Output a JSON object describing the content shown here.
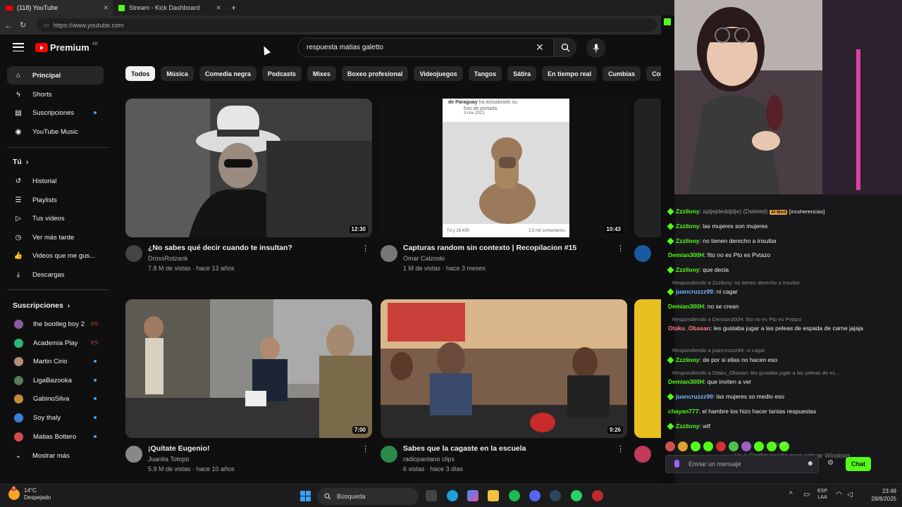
{
  "browser": {
    "tabs": [
      {
        "title": "(118) YouTube",
        "active": true
      },
      {
        "title": "Stream - Kick Dashboard",
        "active": false
      }
    ],
    "url": "https://www.youtube.com"
  },
  "youtube": {
    "logo_text": "Premium",
    "logo_region": "AR",
    "search_value": "respuesta matias galetto",
    "sidebar": {
      "main": [
        {
          "label": "Principal",
          "icon": "home-icon",
          "active": true
        },
        {
          "label": "Shorts",
          "icon": "shorts-icon"
        },
        {
          "label": "Suscripciones",
          "icon": "subscriptions-icon",
          "dot": true
        },
        {
          "label": "YouTube Music",
          "icon": "music-icon"
        }
      ],
      "you_heading": "Tú",
      "you": [
        {
          "label": "Historial",
          "icon": "history-icon"
        },
        {
          "label": "Playlists",
          "icon": "playlists-icon"
        },
        {
          "label": "Tus videos",
          "icon": "your-videos-icon"
        },
        {
          "label": "Ver más tarde",
          "icon": "clock-icon"
        },
        {
          "label": "Videos que me gus...",
          "icon": "thumbs-up-icon"
        },
        {
          "label": "Descargas",
          "icon": "download-icon"
        }
      ],
      "subs_heading": "Suscripciones",
      "subs": [
        {
          "label": "the bootleg boy 2",
          "color": "#8a5a9e",
          "live": true
        },
        {
          "label": "Academia Play",
          "color": "#2bb673",
          "live": true
        },
        {
          "label": "Martin Cirio",
          "color": "#b58d7a",
          "dot": true
        },
        {
          "label": "LigaBazooka",
          "color": "#5a7a5a",
          "dot": true
        },
        {
          "label": "GabinoSilva",
          "color": "#c48a3a",
          "dot": true
        },
        {
          "label": "Soy thaly",
          "color": "#3a7fd8",
          "dot": true
        },
        {
          "label": "Matias Bottero",
          "color": "#d44a4a",
          "dot": true
        }
      ],
      "more_label": "Mostrar más"
    },
    "chips": [
      "Todos",
      "Música",
      "Comedia negra",
      "Podcasts",
      "Mixes",
      "Boxeo profesional",
      "Videojuegos",
      "Tangos",
      "Sátira",
      "En tiempo real",
      "Cumbias",
      "Come"
    ],
    "videos": [
      {
        "title": "¿No sabes qué decir cuando te insultan?",
        "channel": "DrossRotzank",
        "meta": "7.8 M de vistas · hace 13 años",
        "duration": "12:30",
        "avatar_color": "#444"
      },
      {
        "title": "Capturas random sin contexto | Recopilacion #15",
        "channel": "Omar Calzoski",
        "meta": "1 M de vistas · hace 3 meses",
        "duration": "10:43",
        "avatar_color": "#777",
        "inner_lines": [
          "de Paraguay",
          "ha actualizado su",
          "foto de portada.",
          "3 nov 2021",
          "Tú y 18.439",
          "2,5 mil comentarios"
        ]
      },
      {
        "title": "¡Quítate Eugenio!",
        "channel": "Juanita Totopo",
        "meta": "5.9 M de vistas · hace 10 años",
        "duration": "7:00",
        "avatar_color": "#888"
      },
      {
        "title": "Sabes que la cagaste en la escuela",
        "channel": "radiopantano clips",
        "meta": "6 vistas · hace 3 días",
        "duration": "9:26",
        "avatar_color": "#2a8a4a"
      }
    ]
  },
  "kick": {
    "messages": [
      {
        "user": "Zzzilony",
        "text": "[incoherencias]",
        "deleted_text": "ajdjejdeddjdje)",
        "deleted_tag": "(Deleted)",
        "mod_tag": "AI Mod",
        "badge": true,
        "color": "green"
      },
      {
        "user": "Zzzilony",
        "text": "las mujeres son mujeres",
        "badge": true,
        "color": "green"
      },
      {
        "user": "Zzzilony",
        "text": "no tienen derecho a insultar",
        "badge": true,
        "color": "green"
      },
      {
        "user": "Demian300H",
        "text": "fito no es Pto es Pvtazo",
        "color": "green"
      },
      {
        "user": "Zzzilony",
        "text": "que decia",
        "badge": true,
        "color": "green"
      },
      {
        "reply": "Respondiendo a Zzzilony: no tienen derecho a insultar"
      },
      {
        "user": "juancruzzz99",
        "text": "ni cagar",
        "badge": true,
        "color": "blue"
      },
      {
        "user": "Demian300H",
        "text": "no se crean",
        "color": "green"
      },
      {
        "reply": "Respondiendo a Demian300H: fito no es Pto es Pvtazo"
      },
      {
        "user": "Otaku_Obasan",
        "text": "les gustaba jugar a las peleas de espada de carne jajaja",
        "color": "red"
      },
      {
        "reply": "Respondiendo a juancruzzz99: ni cagar"
      },
      {
        "user": "Zzzilony",
        "text": "de por si ellas no hacen eso",
        "badge": true,
        "color": "green"
      },
      {
        "reply": "Respondiendo a Otaku_Obasan: les gustaba jugar a las peleas de es..."
      },
      {
        "user": "Demian300H",
        "text": "que inviten a ver",
        "color": "green"
      },
      {
        "user": "juancruzzz99",
        "text": "las mujeres so medio eso",
        "badge": true,
        "color": "blue"
      },
      {
        "user": "chayan777",
        "text": "el hambre los hizo hacer tantas respuestas",
        "color": "green"
      },
      {
        "user": "Zzzilony",
        "text": "wtf",
        "badge": true,
        "color": "green"
      }
    ],
    "input_placeholder": "Enviar un mensaje",
    "chat_button": "Chat",
    "watermark_title": "ows",
    "watermark_line": "Ve a Configuración para activar Windows."
  },
  "taskbar": {
    "weather_temp": "14°C",
    "weather_desc": "Despejado",
    "notif_count": "6",
    "search_label": "Búsqueda",
    "lang_top": "ESP",
    "lang_bottom": "LAA",
    "time": "23:49",
    "date": "28/8/2025"
  }
}
